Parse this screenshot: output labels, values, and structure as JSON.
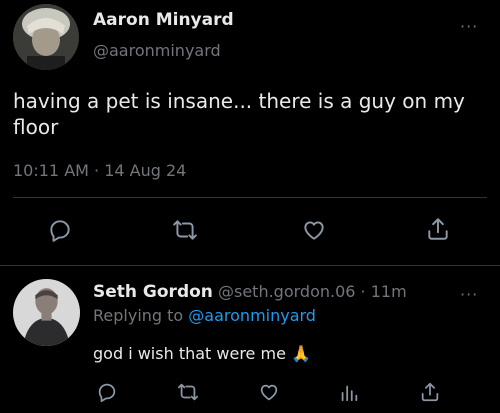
{
  "main_tweet": {
    "author_name": "Aaron Minyard",
    "author_handle": "@aaronminyard",
    "text": "having a pet is insane... there is a guy on my floor",
    "timestamp": "10:11 AM · 14 Aug 24"
  },
  "reply_tweet": {
    "author_name": "Seth Gordon",
    "author_handle": "@seth.gordon.06",
    "time_ago": "11m",
    "replying_label": "Replying to",
    "replying_handle": "@aaronminyard",
    "text": "god i wish that were me",
    "emoji": "🙏"
  },
  "more_label": "···",
  "icons": {
    "main_actions": [
      "reply-icon",
      "retweet-icon",
      "like-icon",
      "share-icon"
    ],
    "reply_actions": [
      "reply-icon",
      "retweet-icon",
      "like-icon",
      "analytics-icon",
      "share-icon"
    ]
  },
  "colors": {
    "background": "#000000",
    "primary_text": "#e7e9ea",
    "secondary_text": "#71767b",
    "link": "#1d9bf0",
    "divider": "#2f3336"
  }
}
